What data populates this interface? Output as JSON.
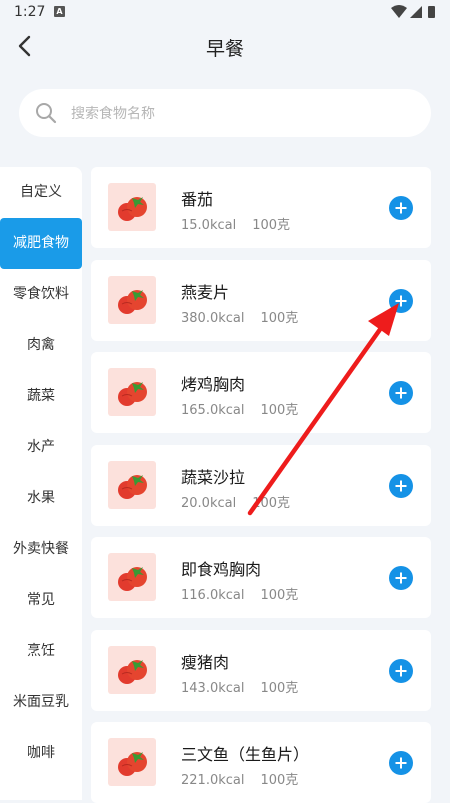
{
  "status": {
    "time": "1:27",
    "notif": "A"
  },
  "header": {
    "title": "早餐"
  },
  "search": {
    "placeholder": "搜索食物名称",
    "value": ""
  },
  "sidebar": {
    "items": [
      {
        "label": "自定义",
        "active": false
      },
      {
        "label": "减肥食物",
        "active": true
      },
      {
        "label": "零食饮料",
        "active": false
      },
      {
        "label": "肉禽",
        "active": false
      },
      {
        "label": "蔬菜",
        "active": false
      },
      {
        "label": "水产",
        "active": false
      },
      {
        "label": "水果",
        "active": false
      },
      {
        "label": "外卖快餐",
        "active": false
      },
      {
        "label": "常见",
        "active": false
      },
      {
        "label": "烹饪",
        "active": false
      },
      {
        "label": "米面豆乳",
        "active": false
      },
      {
        "label": "咖啡",
        "active": false
      }
    ]
  },
  "foods": [
    {
      "name": "番茄",
      "kcal": "15.0kcal",
      "amount": "100克"
    },
    {
      "name": "燕麦片",
      "kcal": "380.0kcal",
      "amount": "100克"
    },
    {
      "name": "烤鸡胸肉",
      "kcal": "165.0kcal",
      "amount": "100克"
    },
    {
      "name": "蔬菜沙拉",
      "kcal": "20.0kcal",
      "amount": "100克"
    },
    {
      "name": "即食鸡胸肉",
      "kcal": "116.0kcal",
      "amount": "100克"
    },
    {
      "name": "瘦猪肉",
      "kcal": "143.0kcal",
      "amount": "100克"
    },
    {
      "name": "三文鱼（生鱼片）",
      "kcal": "221.0kcal",
      "amount": "100克"
    }
  ],
  "icons": {
    "back": "back-arrow-icon",
    "search": "search-icon",
    "add": "plus-icon",
    "food": "tomato-icon"
  },
  "colors": {
    "accent": "#1a9be8",
    "add_button": "#1592e6",
    "annotation_arrow": "#ee1c1c",
    "thumb_bg": "#fce1dc"
  }
}
